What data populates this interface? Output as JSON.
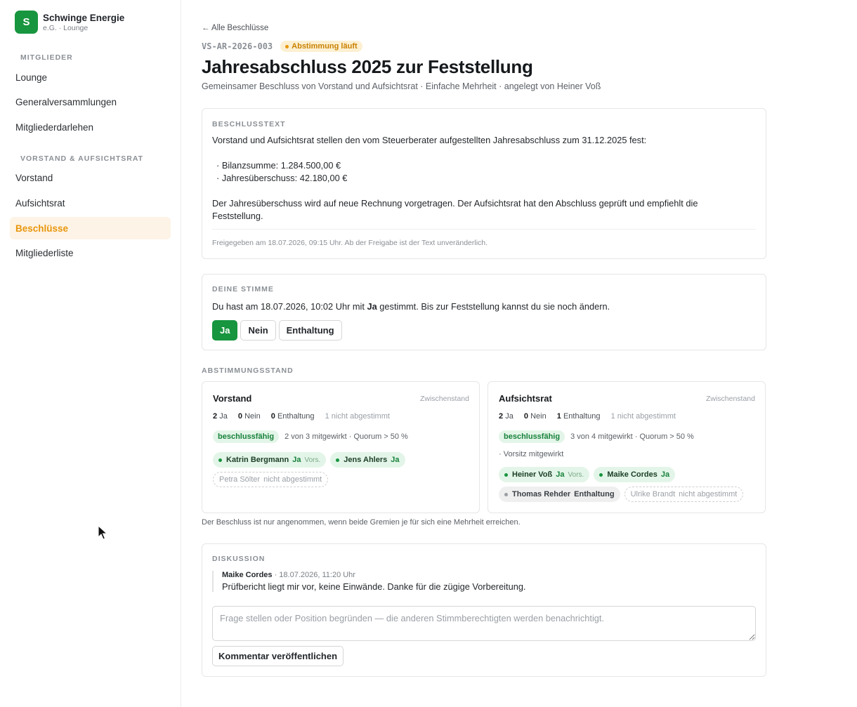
{
  "brand": {
    "logo_letter": "S",
    "name": "Schwinge Energie",
    "sub": "e.G. · Lounge",
    "color": "#17953f"
  },
  "sidebar": {
    "sections": [
      {
        "label": "MITGLIEDER",
        "items": [
          "Lounge",
          "Generalversammlungen",
          "Mitgliederdarlehen"
        ]
      },
      {
        "label": "VORSTAND & AUFSICHTSRAT",
        "items": [
          "Vorstand",
          "Aufsichtsrat",
          "Beschlüsse",
          "Mitgliederliste"
        ]
      }
    ],
    "active_item": "Beschlüsse",
    "active_color": "#e8960c"
  },
  "header": {
    "back_link": "← Alle Beschlüsse",
    "ref_id": "VS-AR-2026-003",
    "status": "Abstimmung läuft",
    "title": "Jahresabschluss 2025 zur Feststellung",
    "subtitle": "Gemeinsamer Beschluss von Vorstand und Aufsichtsrat · Einfache Mehrheit · angelegt von Heiner Voß"
  },
  "resolution": {
    "label": "BESCHLUSSTEXT",
    "intro": "Vorstand und Aufsichtsrat stellen den vom Steuerberater aufgestellten Jahresabschluss zum 31.12.2025 fest:",
    "bullets": [
      "· Bilanzsumme: 1.284.500,00 €",
      "· Jahresüberschuss: 42.180,00 €"
    ],
    "closing_line1": "Der Jahresüberschuss wird auf neue Rechnung vorgetragen. Der Aufsichtsrat hat den Abschluss geprüft und empfiehlt die",
    "closing_line2": "Feststellung.",
    "footnote": "Freigegeben am 18.07.2026, 09:15 Uhr. Ab der Freigabe ist der Text unveränderlich."
  },
  "my_vote": {
    "label": "DEINE STIMME",
    "text_before": "Du hast am 18.07.2026, 10:02 Uhr mit ",
    "vote_word": "Ja",
    "text_after": " gestimmt. Bis zur Feststellung kannst du sie noch ändern.",
    "options": [
      "Ja",
      "Nein",
      "Enthaltung"
    ],
    "selected": "Ja"
  },
  "tally": {
    "label": "ABSTIMMUNGSSTAND",
    "bodies": [
      {
        "name": "Vorstand",
        "interim": "Zwischenstand",
        "counts": {
          "ja": "2",
          "ja_label": "Ja",
          "nein": "0",
          "nein_label": "Nein",
          "enthaltung": "0",
          "enthaltung_label": "Enthaltung",
          "offen": "1 nicht abgestimmt"
        },
        "quorum_badge": "beschlussfähig",
        "quorum_text": "2 von 3 mitgewirkt · Quorum > 50 %",
        "note": "",
        "members": [
          {
            "name": "Katrin Bergmann",
            "vote": "Ja",
            "role": "Vors.",
            "type": "yes"
          },
          {
            "name": "Jens Ahlers",
            "vote": "Ja",
            "role": "",
            "type": "yes"
          },
          {
            "name": "Petra Sölter",
            "vote": "nicht abgestimmt",
            "role": "",
            "type": "none"
          }
        ]
      },
      {
        "name": "Aufsichtsrat",
        "interim": "Zwischenstand",
        "counts": {
          "ja": "2",
          "ja_label": "Ja",
          "nein": "0",
          "nein_label": "Nein",
          "enthaltung": "1",
          "enthaltung_label": "Enthaltung",
          "offen": "1 nicht abgestimmt"
        },
        "quorum_badge": "beschlussfähig",
        "quorum_text": "3 von 4 mitgewirkt · Quorum > 50 %",
        "note": "· Vorsitz mitgewirkt",
        "members": [
          {
            "name": "Heiner Voß",
            "vote": "Ja",
            "role": "Vors.",
            "type": "yes"
          },
          {
            "name": "Maike Cordes",
            "vote": "Ja",
            "role": "",
            "type": "yes"
          },
          {
            "name": "Thomas Rehder",
            "vote": "Enthaltung",
            "role": "",
            "type": "abst"
          },
          {
            "name": "Ulrike Brandt",
            "vote": "nicht abgestimmt",
            "role": "",
            "type": "none"
          }
        ]
      }
    ],
    "rule_note": "Der Beschluss ist nur angenommen, wenn beide Gremien je für sich eine Mehrheit erreichen."
  },
  "discussion": {
    "label": "DISKUSSION",
    "comment": {
      "author": "Maike Cordes",
      "meta": " · 18.07.2026, 11:20 Uhr",
      "text": "Prüfbericht liegt mir vor, keine Einwände. Danke für die zügige Vorbereitung."
    },
    "input_placeholder": "Frage stellen oder Position begründen — die anderen Stimmberechtigten werden benachrichtigt.",
    "input_value": "",
    "publish_label": "Kommentar veröffentlichen"
  }
}
